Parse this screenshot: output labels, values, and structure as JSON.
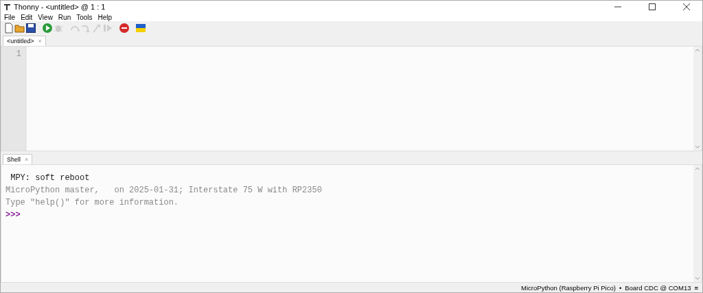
{
  "window": {
    "title": "Thonny  -  <untitled>  @  1 : 1"
  },
  "menu": [
    "File",
    "Edit",
    "View",
    "Run",
    "Tools",
    "Help"
  ],
  "toolbar": [
    {
      "kind": "new",
      "disabled": false
    },
    {
      "kind": "open",
      "disabled": false
    },
    {
      "kind": "save",
      "disabled": false
    },
    {
      "kind": "run",
      "disabled": false
    },
    {
      "kind": "debug",
      "disabled": true
    },
    {
      "kind": "step-over",
      "disabled": true
    },
    {
      "kind": "step-into",
      "disabled": true
    },
    {
      "kind": "step-out",
      "disabled": true
    },
    {
      "kind": "resume",
      "disabled": true
    },
    {
      "kind": "stop",
      "disabled": false
    },
    {
      "kind": "flag",
      "disabled": false
    }
  ],
  "editor": {
    "tab": {
      "label": "<untitled>",
      "close": "×"
    },
    "line_numbers": [
      "1"
    ]
  },
  "shell": {
    "tab": {
      "label": "Shell",
      "close": "×"
    },
    "lines": [
      {
        "kind": "output",
        "text": " MPY: soft reboot"
      },
      {
        "kind": "info",
        "text": "MicroPython master,   on 2025-01-31; Interstate 75 W with RP2350"
      },
      {
        "kind": "info",
        "text": "Type \"help()\" for more information."
      },
      {
        "kind": "prompt",
        "text": ">>>"
      }
    ]
  },
  "status_bar": {
    "interpreter": "MicroPython (Raspberry Pi Pico)",
    "separator": "•",
    "port": "Board CDC @ COM13",
    "menu": "≡"
  }
}
